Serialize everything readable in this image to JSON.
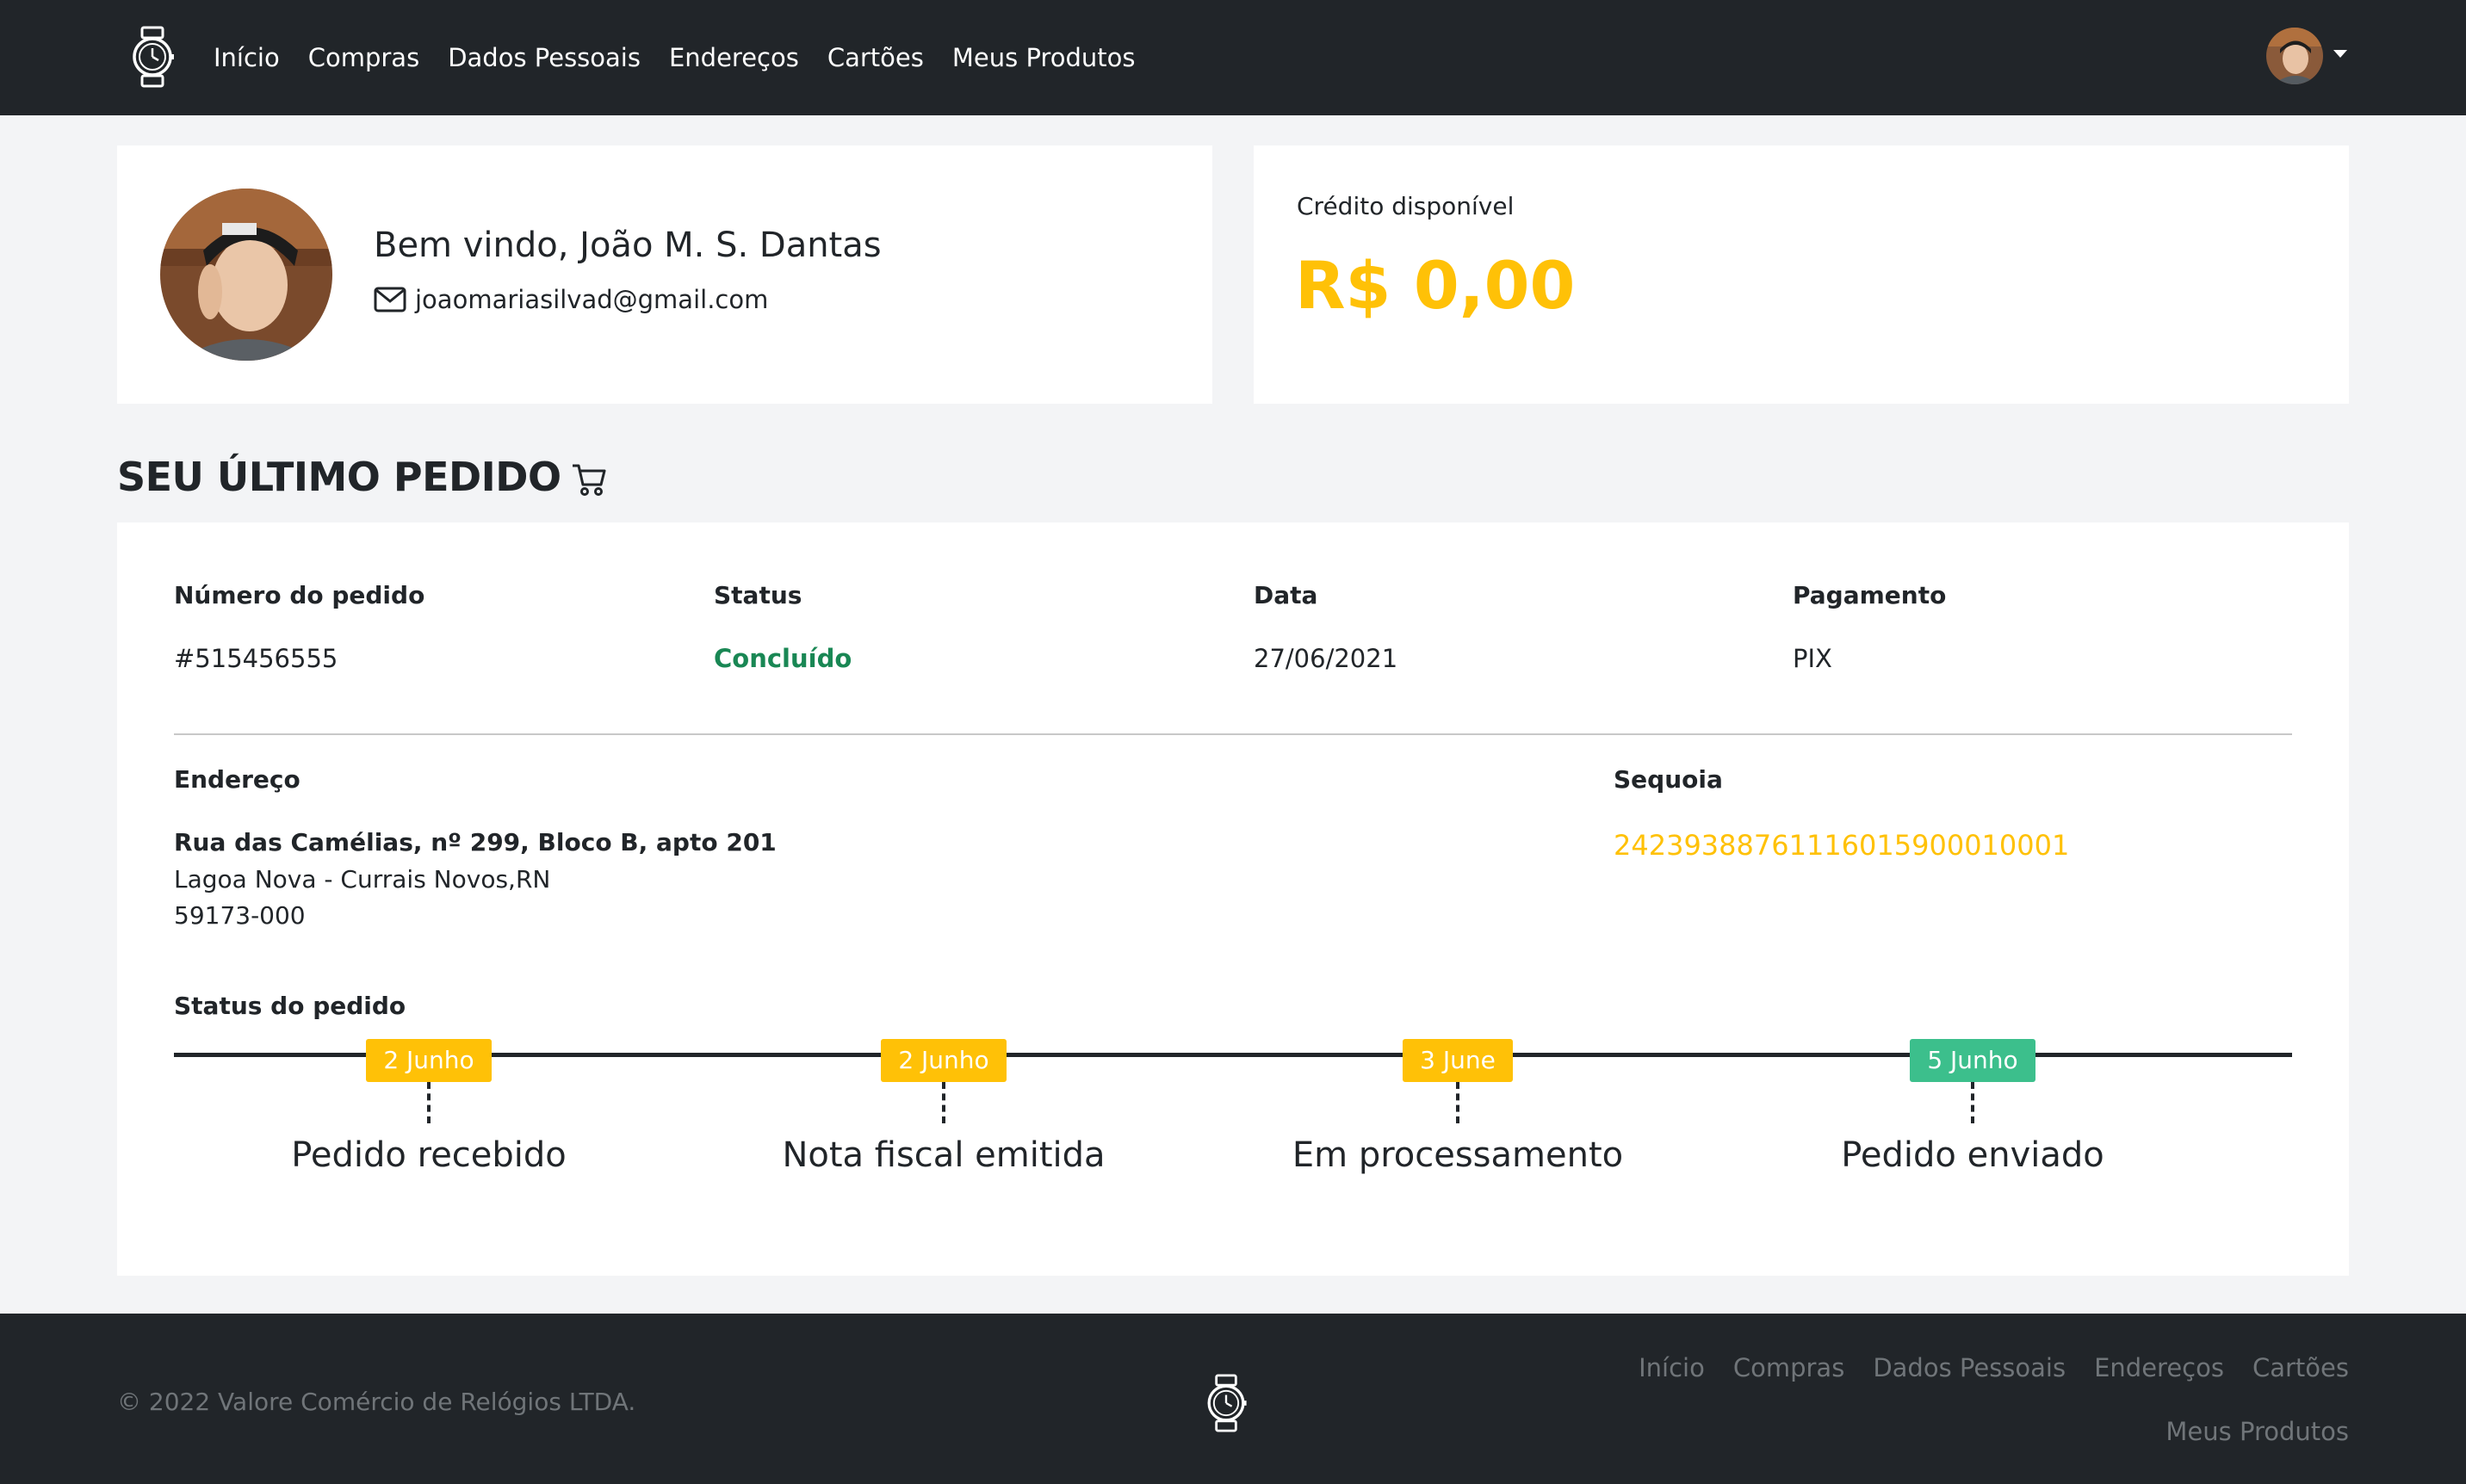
{
  "nav": {
    "links": [
      "Início",
      "Compras",
      "Dados Pessoais",
      "Endereços",
      "Cartões",
      "Meus Produtos"
    ]
  },
  "profile": {
    "welcome": "Bem vindo, João M. S. Dantas",
    "email": "joaomariasilvad@gmail.com"
  },
  "credit": {
    "label": "Crédito disponível",
    "value": "R$ 0,00"
  },
  "last_order": {
    "title": "SEU ÚLTIMO PEDIDO",
    "number_label": "Número do pedido",
    "number": "#515456555",
    "status_label": "Status",
    "status": "Concluído",
    "date_label": "Data",
    "date": "27/06/2021",
    "payment_label": "Pagamento",
    "payment": "PIX",
    "address_label": "Endereço",
    "address_street": "Rua das Camélias, nº 299, Bloco B, apto 201",
    "address_city": "Lagoa Nova - Currais Novos,RN",
    "address_zip": "59173-000",
    "carrier_label": "Sequoia",
    "tracking_code": "24239388761116015900010001",
    "timeline_label": "Status do pedido",
    "timeline": [
      {
        "date": "2 Junho",
        "label": "Pedido recebido",
        "color": "#ffc107"
      },
      {
        "date": "2 Junho",
        "label": "Nota fiscal emitida",
        "color": "#ffc107"
      },
      {
        "date": "3 June",
        "label": "Em processamento",
        "color": "#ffc107"
      },
      {
        "date": "5 Junho",
        "label": "Pedido enviado",
        "color": "#3cbf8c"
      }
    ]
  },
  "footer": {
    "copyright": "© 2022 Valore Comércio de Relógios LTDA.",
    "links": [
      "Início",
      "Compras",
      "Dados Pessoais",
      "Endereços",
      "Cartões",
      "Meus Produtos"
    ]
  },
  "colors": {
    "dark": "#212529",
    "accent": "#ffc107",
    "success": "#198754",
    "teal_badge": "#3cbf8c"
  },
  "icons": [
    "watch-logo-icon",
    "envelope-icon",
    "cart-icon",
    "caret-down-icon"
  ]
}
